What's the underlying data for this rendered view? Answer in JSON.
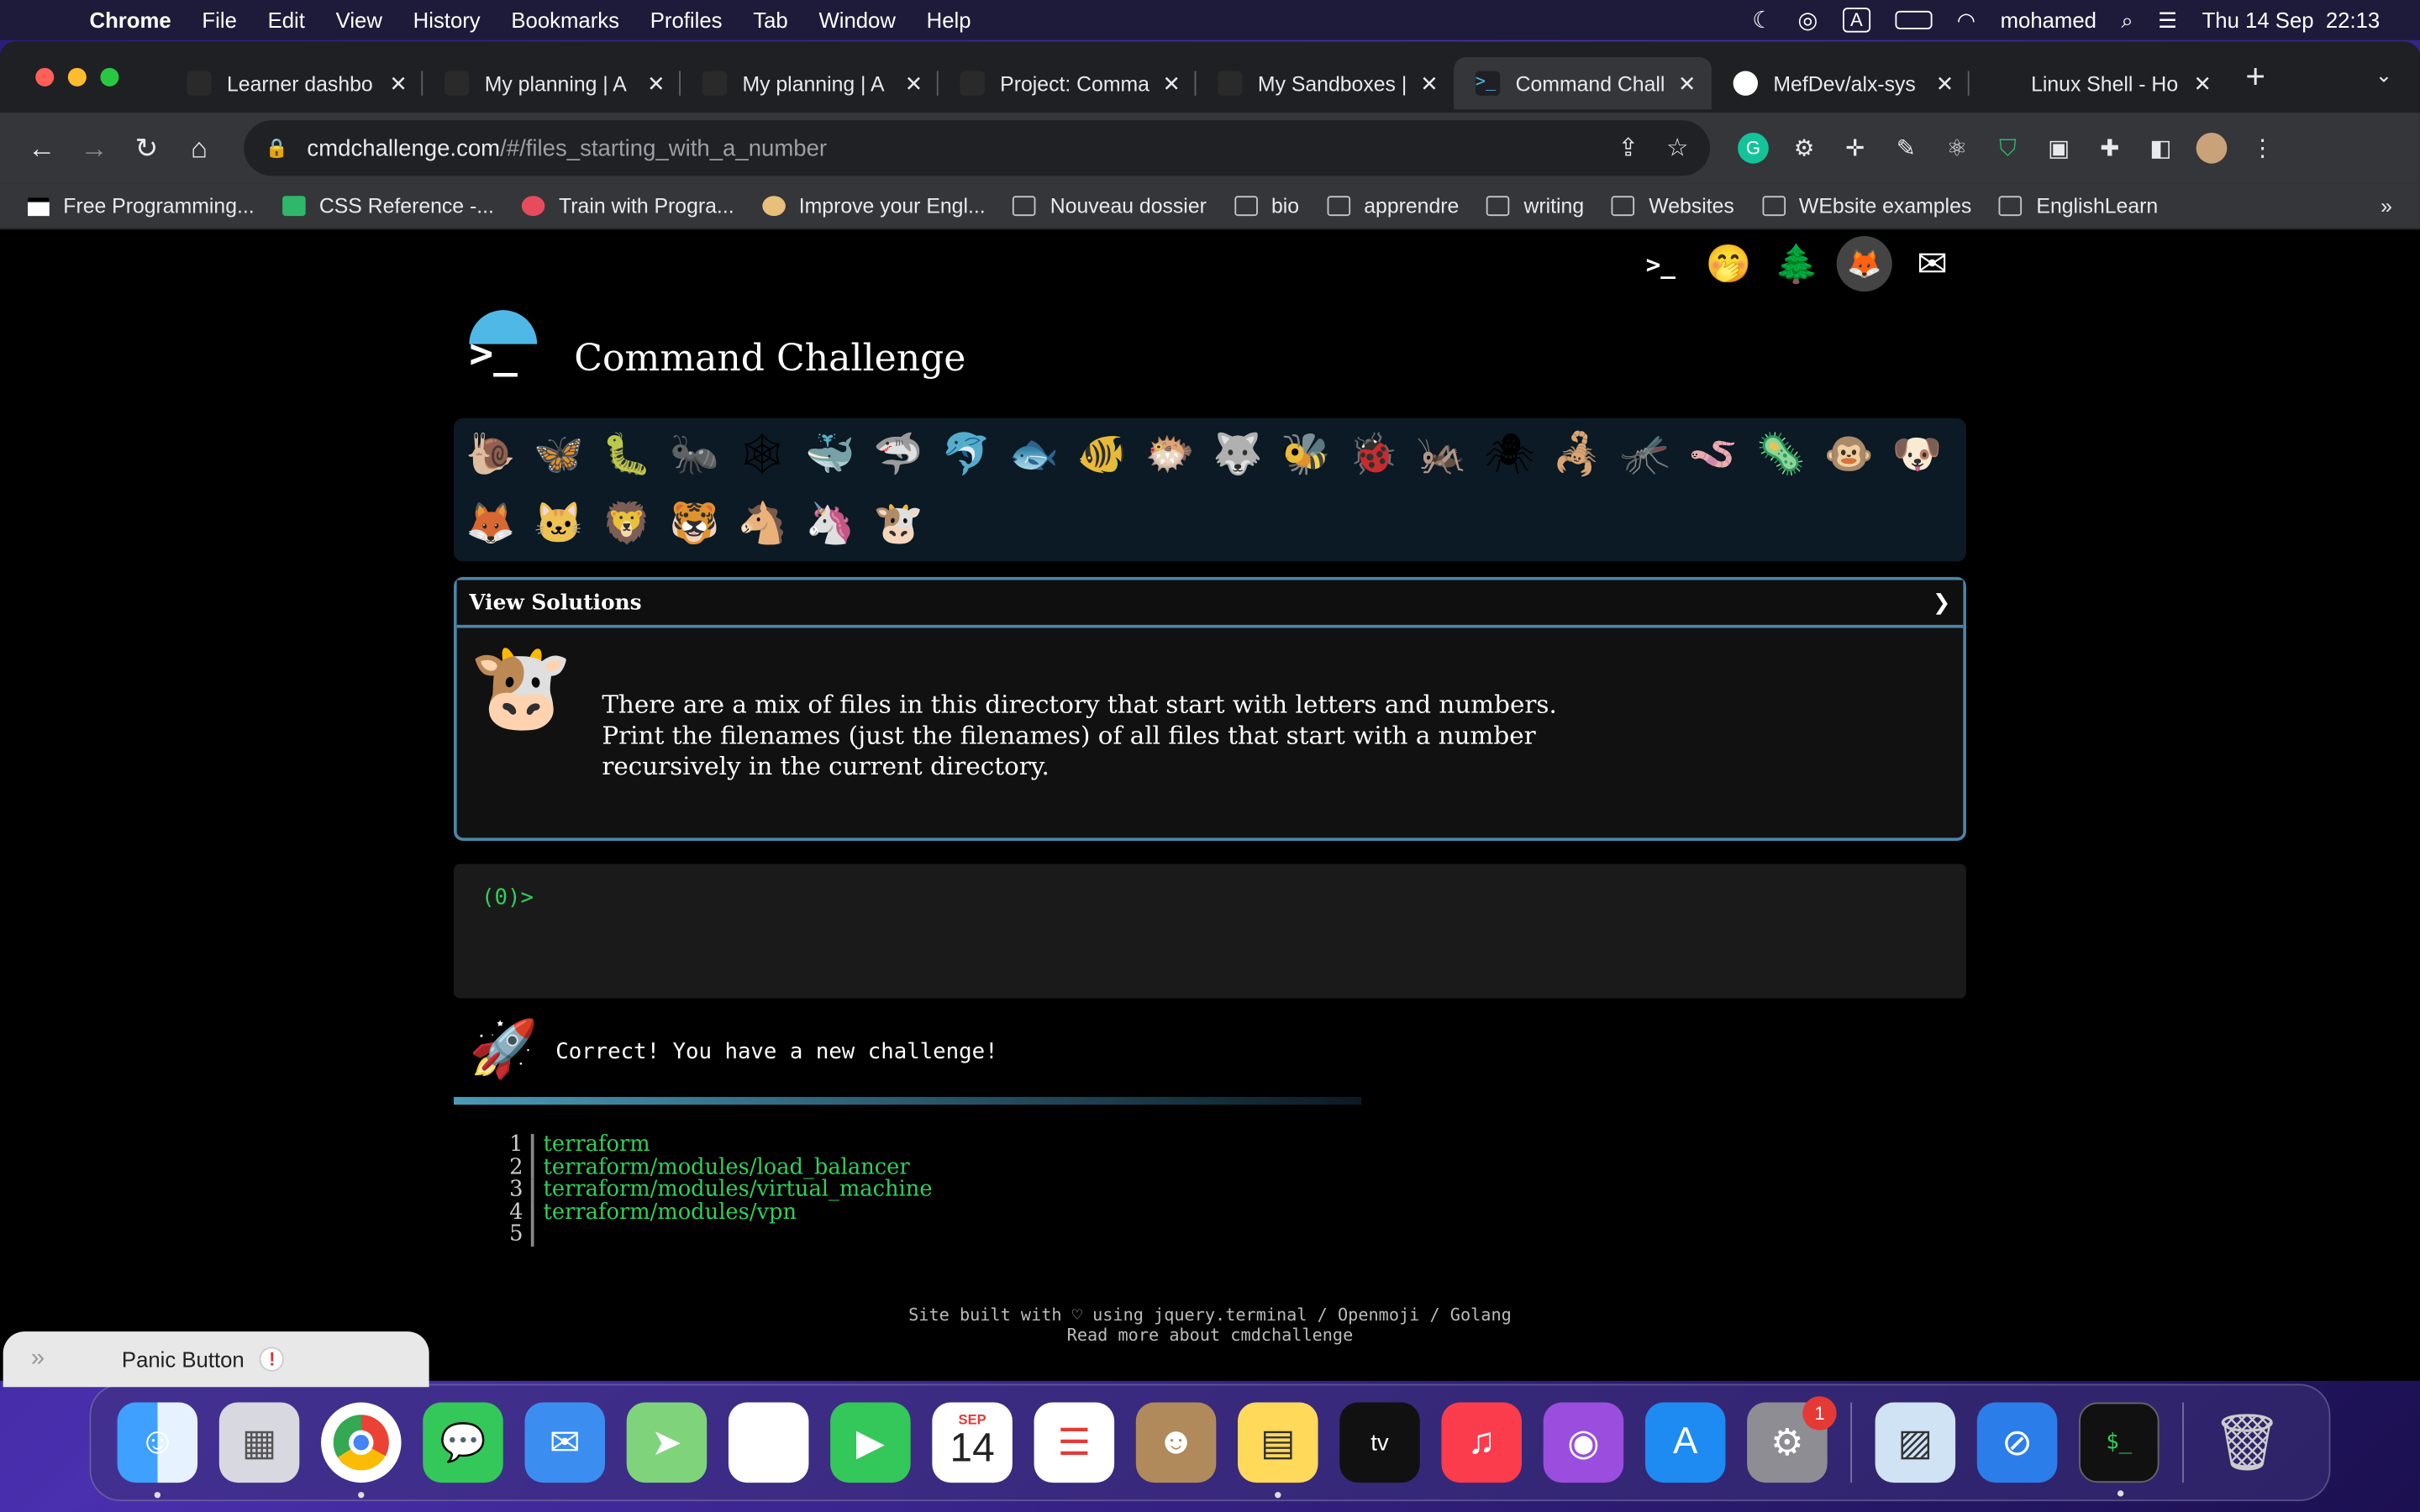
{
  "menubar": {
    "app": "Chrome",
    "items": [
      "File",
      "Edit",
      "View",
      "History",
      "Bookmarks",
      "Profiles",
      "Tab",
      "Window",
      "Help"
    ],
    "user": "mohamed",
    "datetime": "Thu 14 Sep  22:13",
    "input_indicator": "A"
  },
  "tabs": [
    {
      "title": "Learner dashbo",
      "color": "#2a2a2a"
    },
    {
      "title": "My planning | A",
      "color": "#2a2a2a"
    },
    {
      "title": "My planning | A",
      "color": "#2a2a2a"
    },
    {
      "title": "Project: Comma",
      "color": "#2a2a2a"
    },
    {
      "title": "My Sandboxes |",
      "color": "#2a2a2a"
    },
    {
      "title": "Command Chall",
      "color": "#4fb8e6",
      "active": true
    },
    {
      "title": "MefDev/alx-sys",
      "color": "#ffffff"
    },
    {
      "title": "Linux Shell - Ho",
      "color": "#1f2023"
    }
  ],
  "address": {
    "domain": "cmdchallenge.com",
    "path": "/#/files_starting_with_a_number"
  },
  "bookmarks": [
    {
      "label": "Free Programming...",
      "type": "site"
    },
    {
      "label": "CSS Reference -...",
      "type": "site"
    },
    {
      "label": "Train with Progra...",
      "type": "site"
    },
    {
      "label": "Improve your Engl...",
      "type": "site"
    },
    {
      "label": "Nouveau dossier",
      "type": "folder"
    },
    {
      "label": "bio",
      "type": "folder"
    },
    {
      "label": "apprendre",
      "type": "folder"
    },
    {
      "label": "writing",
      "type": "folder"
    },
    {
      "label": "Websites",
      "type": "folder"
    },
    {
      "label": "WEbsite examples",
      "type": "folder"
    },
    {
      "label": "EnglishLearn",
      "type": "folder"
    }
  ],
  "page": {
    "title": "Command Challenge",
    "animals_row1": [
      "🐌",
      "🦋",
      "🐛",
      "🐜",
      "🕸",
      "🐳",
      "🦈",
      "🐬",
      "🐟",
      "🐠",
      "🐡",
      "🐺",
      "🐝",
      "🐞",
      "🦗",
      "🕷",
      "🦂",
      "🦟",
      "🪱",
      "🦠",
      "🐵",
      "🐶"
    ],
    "animals_row2": [
      "🦊",
      "🐱",
      "🦁",
      "🐯",
      "🐴",
      "🦄",
      "🐮"
    ],
    "view_solutions": "View Solutions",
    "task_text": "There are a mix of files in this directory that start with letters and numbers.\nPrint the filenames (just the filenames) of all files that start with a number\nrecursively in the current directory.",
    "prompt": "(0)>",
    "correct_message": "Correct! You have a new challenge!",
    "progress_fraction": 0.6,
    "output_lines": [
      {
        "n": "1",
        "text": "terraform"
      },
      {
        "n": "2",
        "text": "terraform/modules/load_balancer"
      },
      {
        "n": "3",
        "text": "terraform/modules/virtual_machine"
      },
      {
        "n": "4",
        "text": "terraform/modules/vpn"
      },
      {
        "n": "5",
        "text": ""
      }
    ],
    "footer_line1": "Site built with ♡ using jquery.terminal / Openmoji / Golang",
    "footer_line2": "Read more about cmdchallenge"
  },
  "panic": {
    "label": "Panic Button"
  },
  "dock": {
    "calendar_month": "SEP",
    "calendar_day": "14",
    "settings_badge": "1"
  }
}
